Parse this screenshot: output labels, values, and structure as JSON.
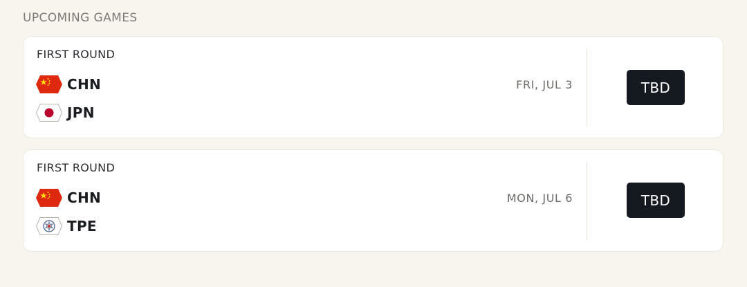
{
  "section_title": "UPCOMING GAMES",
  "games": [
    {
      "round": "FIRST ROUND",
      "home": {
        "code": "CHN",
        "flag_icon": "china-flag-icon"
      },
      "away": {
        "code": "JPN",
        "flag_icon": "japan-flag-icon"
      },
      "date": "FRI, JUL 3",
      "button_label": "TBD"
    },
    {
      "round": "FIRST ROUND",
      "home": {
        "code": "CHN",
        "flag_icon": "china-flag-icon"
      },
      "away": {
        "code": "TPE",
        "flag_icon": "chinese-taipei-flag-icon"
      },
      "date": "MON, JUL 6",
      "button_label": "TBD"
    }
  ],
  "colors": {
    "page_background": "#f8f5ef",
    "card_background": "#ffffff",
    "button_background": "#141a20",
    "button_text": "#ffffff",
    "china_red": "#de2910",
    "china_gold": "#ffde00",
    "japan_red": "#bc002d"
  }
}
